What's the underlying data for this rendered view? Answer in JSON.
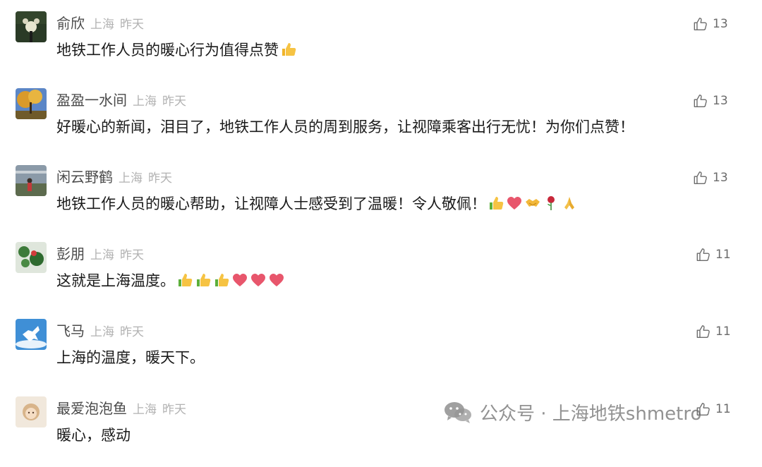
{
  "comments": [
    {
      "nickname": "俞欣",
      "location": "上海",
      "time": "昨天",
      "content": "地铁工作人员的暖心行为值得点赞",
      "likes": "13",
      "emojis": [
        "thumbs-up"
      ]
    },
    {
      "nickname": "盈盈一水间",
      "location": "上海",
      "time": "昨天",
      "content": "好暖心的新闻，泪目了，地铁工作人员的周到服务，让视障乘客出行无忧！为你们点赞！",
      "likes": "13",
      "emojis": []
    },
    {
      "nickname": "闲云野鹤",
      "location": "上海",
      "time": "昨天",
      "content": "地铁工作人员的暖心帮助，让视障人士感受到了温暖！令人敬佩！",
      "likes": "13",
      "emojis": [
        "thumbs-up",
        "heart",
        "handshake",
        "rose",
        "pray"
      ]
    },
    {
      "nickname": "彭朋",
      "location": "上海",
      "time": "昨天",
      "content": "这就是上海温度。",
      "likes": "11",
      "emojis": [
        "thumbs-up",
        "thumbs-up",
        "thumbs-up",
        "heart",
        "heart",
        "heart"
      ]
    },
    {
      "nickname": "飞马",
      "location": "上海",
      "time": "昨天",
      "content": "上海的温度，暖天下。",
      "likes": "11",
      "emojis": []
    },
    {
      "nickname": "最爱泡泡鱼",
      "location": "上海",
      "time": "昨天",
      "content": "暖心，感动",
      "likes": "11",
      "emojis": []
    }
  ],
  "watermark": {
    "text": "公众号 · 上海地铁shmetro",
    "icon": "wechat-icon"
  },
  "colors": {
    "nickname": "#4a4a4a",
    "meta": "#b2b2b2",
    "content": "#1a1a1a",
    "like": "#6b6b6b"
  }
}
